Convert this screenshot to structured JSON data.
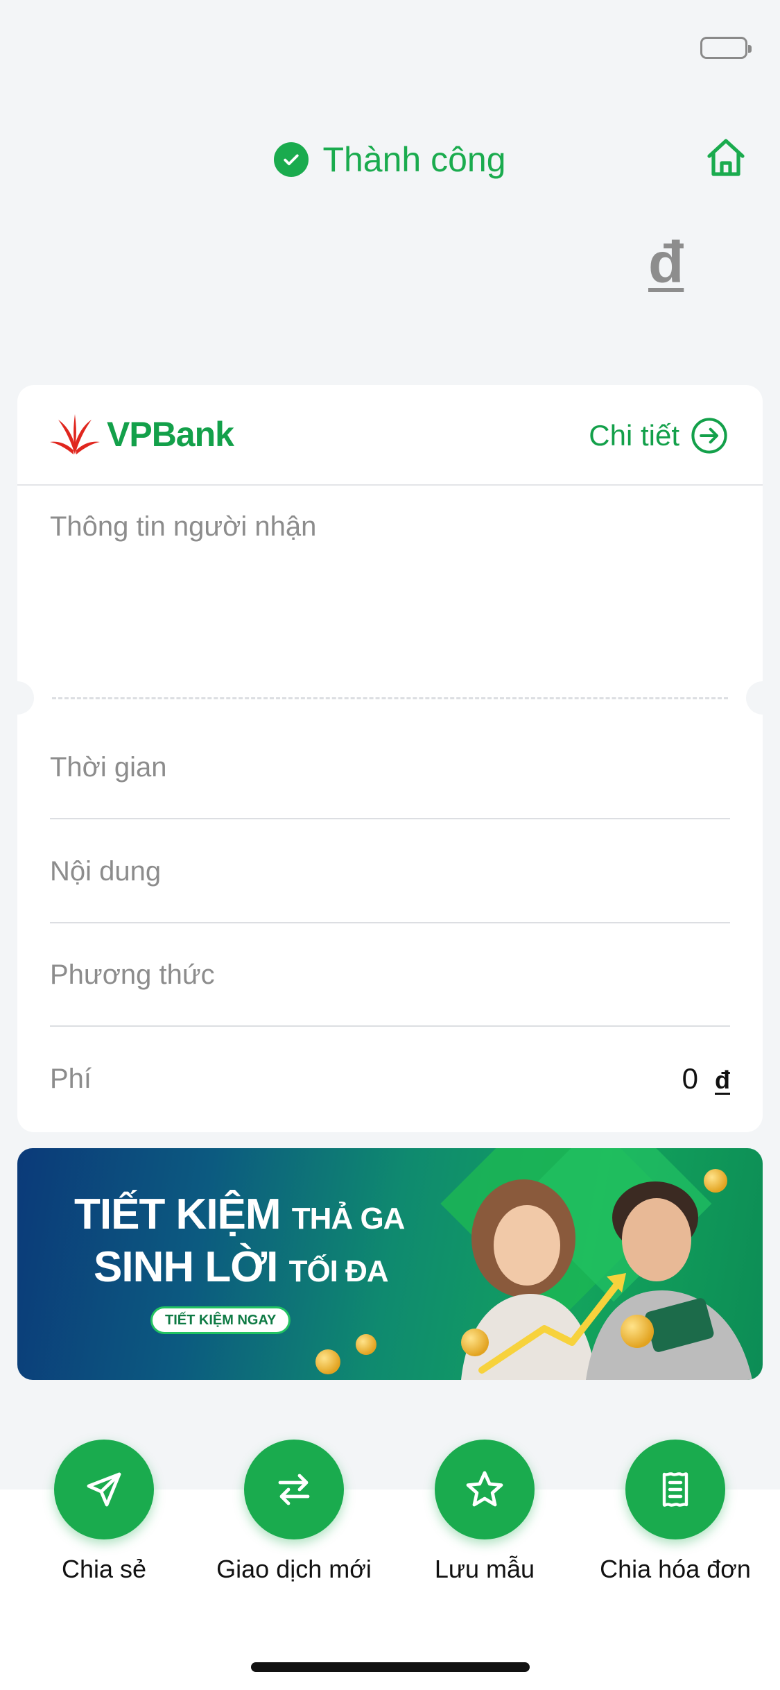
{
  "status": {
    "text": "Thành công",
    "icon": "check-circle-icon",
    "color": "#1aab4e"
  },
  "header": {
    "home_icon": "home-icon"
  },
  "amount": {
    "currency": "đ"
  },
  "card": {
    "bank_name": "VPBank",
    "detail_label": "Chi tiết",
    "detail_icon": "arrow-right-circle-icon",
    "recipient_label": "Thông tin người nhận",
    "rows": [
      {
        "label": "Thời gian"
      },
      {
        "label": "Nội dung"
      },
      {
        "label": "Phương thức"
      },
      {
        "label": "Phí",
        "value": "0",
        "currency": "đ"
      }
    ]
  },
  "banner": {
    "line1_big": "TIẾT KIỆM",
    "line1_small": "THẢ GA",
    "line2_big": "SINH LỜI",
    "line2_small": "TỐI ĐA",
    "cta": "TIẾT KIỆM NGAY"
  },
  "actions": [
    {
      "label": "Chia sẻ",
      "icon": "send-icon"
    },
    {
      "label": "Giao dịch mới",
      "icon": "swap-arrows-icon"
    },
    {
      "label": "Lưu mẫu",
      "icon": "star-icon"
    },
    {
      "label": "Chia hóa đơn",
      "icon": "receipt-icon"
    }
  ],
  "colors": {
    "accent": "#1aab4e",
    "brand_red": "#e0261e",
    "label_gray": "#8c8c8c"
  }
}
